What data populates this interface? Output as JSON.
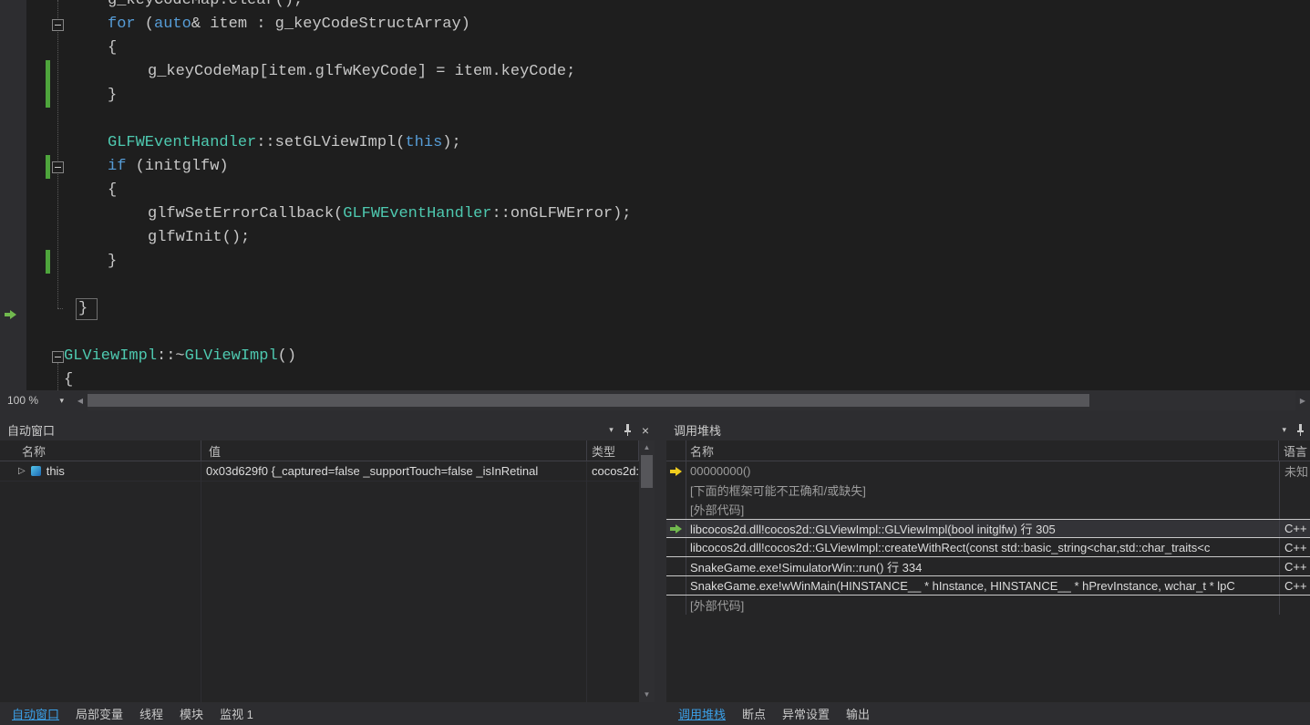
{
  "colors": {
    "keyword": "#569cd6",
    "type_name": "#4ec9b0",
    "code_text": "#c8c8c8",
    "dim_text": "#9d9d9d",
    "accent_blue": "#3ba0e8",
    "green_bar": "#4ea53c",
    "yellow_arrow": "#f0cd1e",
    "green_arrow": "#71b94e"
  },
  "icons": {
    "chevron_down": "▾",
    "close": "×",
    "expander": "▷",
    "scroll_up": "▲",
    "scroll_down": "▼",
    "scroll_left": "◀",
    "scroll_right": "▶"
  },
  "editor": {
    "zoom_value": "100 %",
    "lines": [
      {
        "indent": 1,
        "tokens": [
          [
            "p",
            "g_keyCodeMap.clear();"
          ]
        ]
      },
      {
        "indent": 1,
        "fold": true,
        "tokens": [
          [
            "k",
            "for"
          ],
          [
            "p",
            " ("
          ],
          [
            "k",
            "auto"
          ],
          [
            "p",
            "& item : g_keyCodeStructArray)"
          ]
        ]
      },
      {
        "indent": 1,
        "tokens": [
          [
            "p",
            "{"
          ]
        ]
      },
      {
        "indent": 2,
        "green": true,
        "tokens": [
          [
            "p",
            "g_keyCodeMap[item.glfwKeyCode] = item.keyCode;"
          ]
        ]
      },
      {
        "indent": 1,
        "green": true,
        "tokens": [
          [
            "p",
            "}"
          ]
        ]
      },
      {
        "indent": 0,
        "tokens": []
      },
      {
        "indent": 1,
        "tokens": [
          [
            "t",
            "GLFWEventHandler"
          ],
          [
            "p",
            "::setGLViewImpl("
          ],
          [
            "k",
            "this"
          ],
          [
            "p",
            ");"
          ]
        ]
      },
      {
        "indent": 1,
        "fold": true,
        "green": true,
        "tokens": [
          [
            "k",
            "if"
          ],
          [
            "p",
            " (initglfw)"
          ]
        ]
      },
      {
        "indent": 1,
        "tokens": [
          [
            "p",
            "{"
          ]
        ]
      },
      {
        "indent": 2,
        "tokens": [
          [
            "p",
            "glfwSetErrorCallback("
          ],
          [
            "t",
            "GLFWEventHandler"
          ],
          [
            "p",
            "::onGLFWError);"
          ]
        ]
      },
      {
        "indent": 2,
        "tokens": [
          [
            "p",
            "glfwInit();"
          ]
        ]
      },
      {
        "indent": 1,
        "green": true,
        "tokens": [
          [
            "p",
            "}"
          ]
        ]
      },
      {
        "indent": 0,
        "tokens": []
      },
      {
        "indent": 0,
        "current": true,
        "tokens": [
          [
            "p",
            "}"
          ]
        ]
      },
      {
        "indent": 0,
        "tokens": []
      },
      {
        "indent": 0,
        "fold": true,
        "tokens": [
          [
            "t",
            "GLViewImpl"
          ],
          [
            "p",
            "::~"
          ],
          [
            "t",
            "GLViewImpl"
          ],
          [
            "p",
            "()"
          ]
        ]
      },
      {
        "indent": 0,
        "tokens": [
          [
            "p",
            "{"
          ]
        ]
      }
    ]
  },
  "autos_panel": {
    "title": "自动窗口",
    "columns": [
      "名称",
      "值",
      "类型"
    ],
    "rows": [
      {
        "name": "this",
        "value": "0x03d629f0 {_captured=false _supportTouch=false _isInRetinal",
        "type": "cocos2d:"
      }
    ],
    "tabs": [
      {
        "label": "自动窗口",
        "active": true
      },
      {
        "label": "局部变量",
        "active": false
      },
      {
        "label": "线程",
        "active": false
      },
      {
        "label": "模块",
        "active": false
      },
      {
        "label": "监视 1",
        "active": false
      }
    ]
  },
  "callstack_panel": {
    "title": "调用堆栈",
    "columns": [
      "名称",
      "语言"
    ],
    "frames": [
      {
        "arrow": "yellow",
        "name": "00000000()",
        "lang": "未知",
        "dim": true
      },
      {
        "arrow": "",
        "name": "[下面的框架可能不正确和/或缺失]",
        "lang": "",
        "dim": true
      },
      {
        "arrow": "",
        "name": "[外部代码]",
        "lang": "",
        "dim": true
      },
      {
        "arrow": "green",
        "name": "libcocos2d.dll!cocos2d::GLViewImpl::GLViewImpl(bool initglfw) 行 305",
        "lang": "C++",
        "selected": true
      },
      {
        "arrow": "",
        "name": "libcocos2d.dll!cocos2d::GLViewImpl::createWithRect(const std::basic_string<char,std::char_traits<c",
        "lang": "C++",
        "ruled": true
      },
      {
        "arrow": "",
        "name": "SnakeGame.exe!SimulatorWin::run() 行 334",
        "lang": "C++",
        "ruled": true
      },
      {
        "arrow": "",
        "name": "SnakeGame.exe!wWinMain(HINSTANCE__ * hInstance, HINSTANCE__ * hPrevInstance, wchar_t * lpC",
        "lang": "C++",
        "ruled": true
      },
      {
        "arrow": "",
        "name": "[外部代码]",
        "lang": "",
        "dim": true
      }
    ],
    "tabs": [
      {
        "label": "调用堆栈",
        "active": true
      },
      {
        "label": "断点",
        "active": false
      },
      {
        "label": "异常设置",
        "active": false
      },
      {
        "label": "输出",
        "active": false
      }
    ]
  }
}
